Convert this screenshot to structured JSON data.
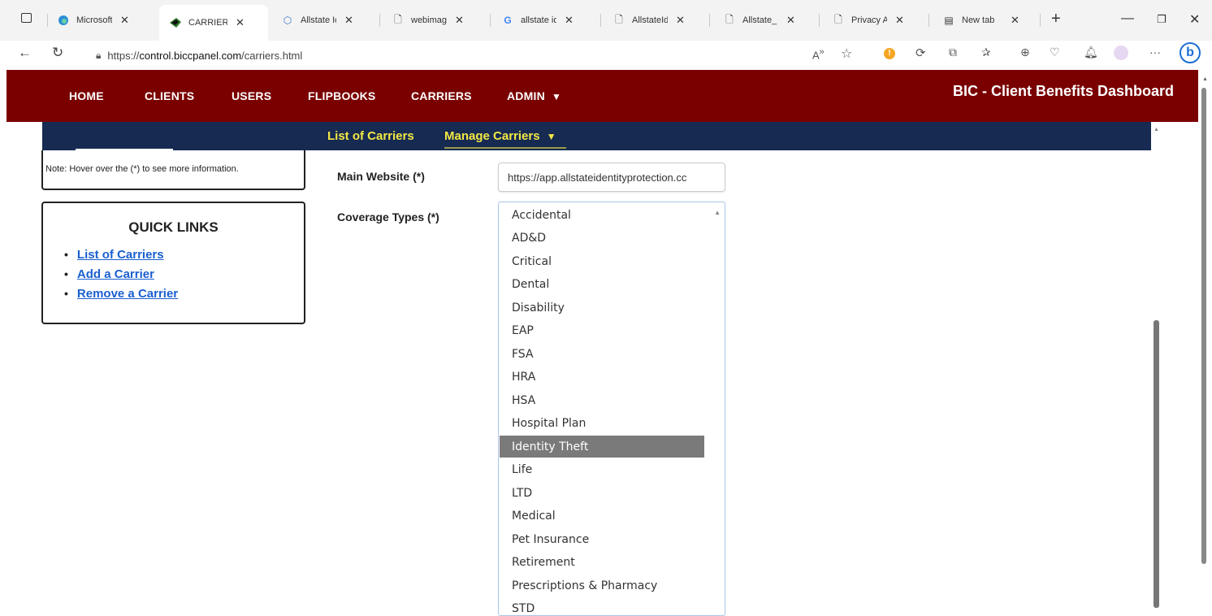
{
  "browser": {
    "tabs": [
      {
        "title": "Microsoft",
        "icon": "edge-icon"
      },
      {
        "title": "CARRIERS",
        "icon": "bic-logo-icon"
      },
      {
        "title": "Allstate Ic",
        "icon": "shield-icon"
      },
      {
        "title": "webimag",
        "icon": "page-icon"
      },
      {
        "title": "allstate id",
        "icon": "google-icon"
      },
      {
        "title": "AllstateId",
        "icon": "page-icon"
      },
      {
        "title": "Allstate_",
        "icon": "page-icon"
      },
      {
        "title": "Privacy A",
        "icon": "page-icon"
      },
      {
        "title": "New tab",
        "icon": "newtab-icon"
      }
    ],
    "url_prefix": "https://",
    "url_domain": "control.biccpanel.com",
    "url_path": "/carriers.html"
  },
  "header": {
    "nav": [
      "HOME",
      "CLIENTS",
      "USERS",
      "FLIPBOOKS",
      "CARRIERS",
      "ADMIN"
    ],
    "title": "BIC - Client Benefits Dashboard"
  },
  "subnav": {
    "list_carriers": "List of Carriers",
    "manage_carriers": "Manage Carriers"
  },
  "sidebar": {
    "note": "Note: Hover over the (*) to see more information.",
    "quick_links_title": "QUICK LINKS",
    "links": [
      "List of Carriers",
      "Add a Carrier",
      "Remove a Carrier"
    ]
  },
  "form": {
    "main_website_label": "Main Website (*)",
    "main_website_value": "https://app.allstateidentityprotection.cc",
    "coverage_types_label": "Coverage Types (*)",
    "coverage_options": [
      "Accidental",
      "AD&D",
      "Critical",
      "Dental",
      "Disability",
      "EAP",
      "FSA",
      "HRA",
      "HSA",
      "Hospital Plan",
      "Identity Theft",
      "Life",
      "LTD",
      "Medical",
      "Pet Insurance",
      "Retirement",
      "Prescriptions & Pharmacy",
      "STD"
    ],
    "selected_option": "Identity Theft"
  },
  "colors": {
    "header_bg": "#7a0000",
    "subnav_bg": "#162a52",
    "subnav_text": "#f4e843",
    "link": "#1a5fd0",
    "selected_bg": "#7a7a7a"
  }
}
